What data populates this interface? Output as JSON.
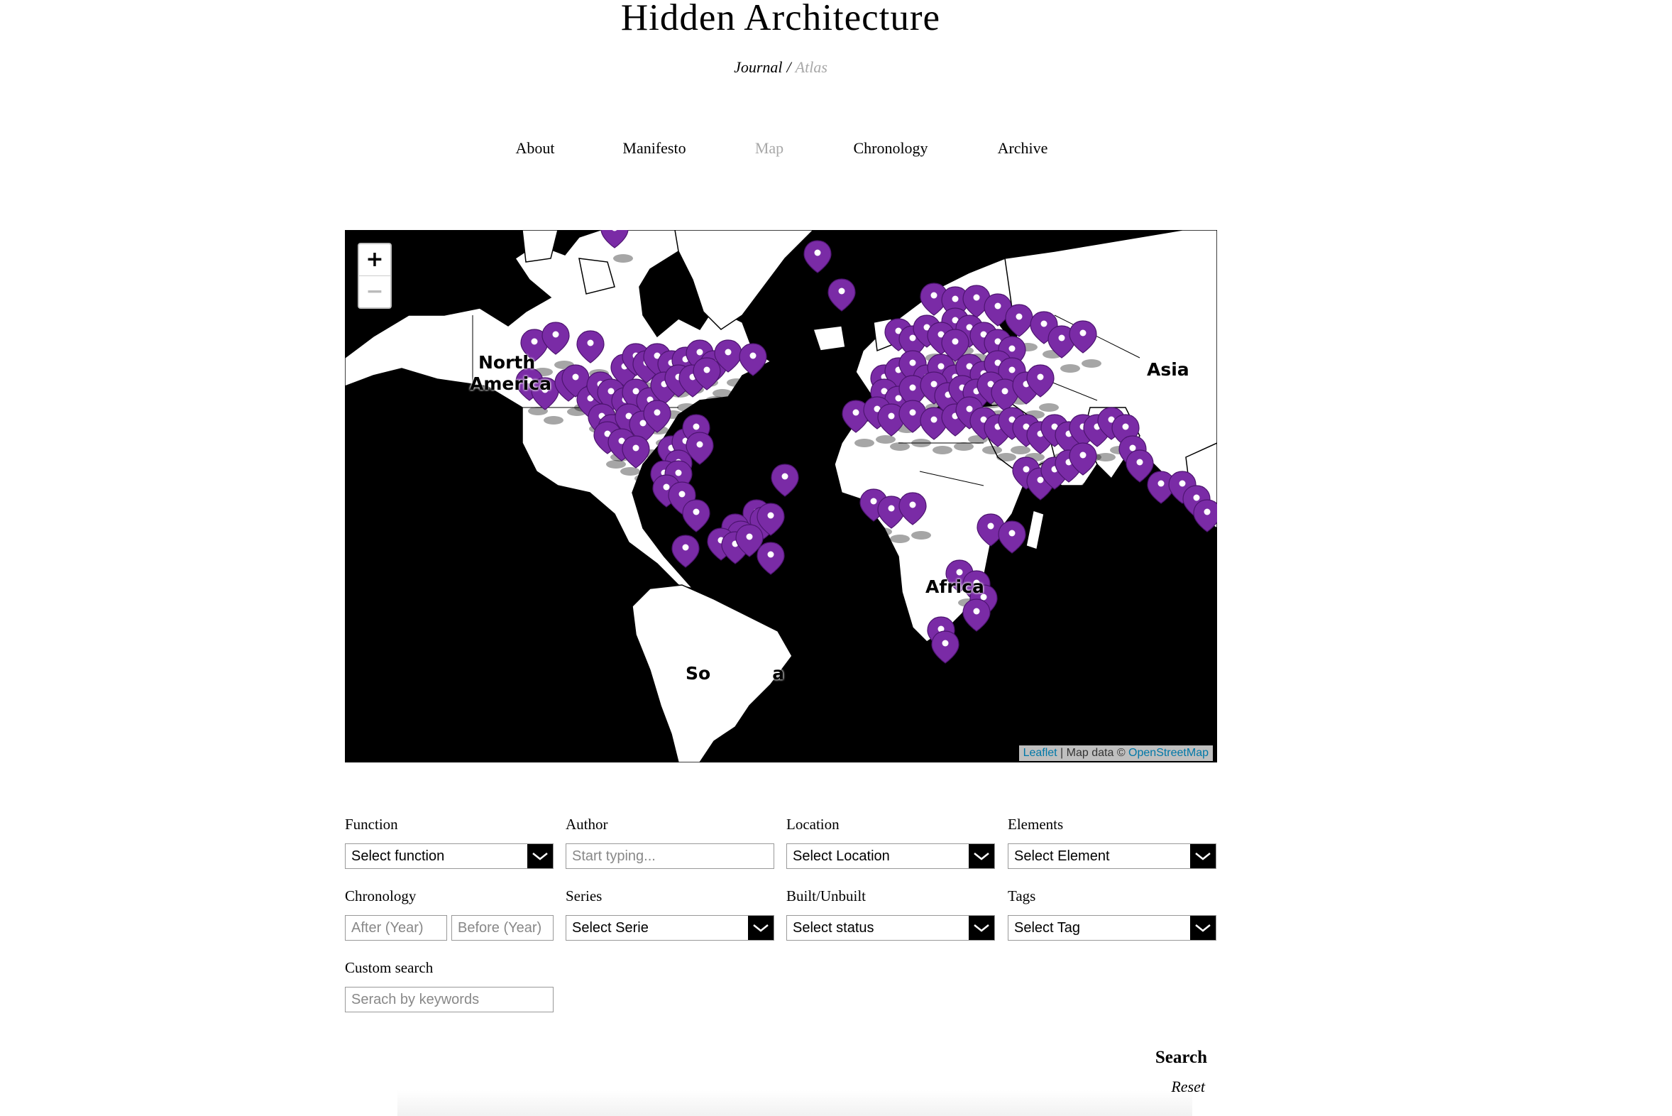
{
  "site": {
    "title": "Hidden Architecture",
    "journal": "Journal",
    "separator": "/",
    "atlas": "Atlas"
  },
  "nav": {
    "items": [
      {
        "label": "About",
        "active": false
      },
      {
        "label": "Manifesto",
        "active": false
      },
      {
        "label": "Map",
        "active": true
      },
      {
        "label": "Chronology",
        "active": false
      },
      {
        "label": "Archive",
        "active": false
      }
    ]
  },
  "map": {
    "zoom_in": "+",
    "zoom_out": "−",
    "labels": {
      "north_america_1": "North",
      "north_america_2": "America",
      "asia": "Asia",
      "africa": "Africa",
      "south_america": "So          a"
    },
    "attribution": {
      "leaflet": "Leaflet",
      "divider": " | Map data © ",
      "osm": "OpenStreetMap"
    },
    "marker_color": "#7a2ba6"
  },
  "filters": {
    "function": {
      "label": "Function",
      "value": "Select function"
    },
    "author": {
      "label": "Author",
      "placeholder": "Start typing..."
    },
    "location": {
      "label": "Location",
      "value": "Select Location"
    },
    "elements": {
      "label": "Elements",
      "value": "Select Element"
    },
    "chronology": {
      "label": "Chronology",
      "after_placeholder": "After (Year)",
      "before_placeholder": "Before (Year)"
    },
    "series": {
      "label": "Series",
      "value": "Select Serie"
    },
    "built": {
      "label": "Built/Unbuilt",
      "value": "Select status"
    },
    "tags": {
      "label": "Tags",
      "value": "Select Tag"
    },
    "custom": {
      "label": "Custom search",
      "placeholder": "Serach by keywords"
    }
  },
  "actions": {
    "search": "Search",
    "reset": "Reset"
  }
}
